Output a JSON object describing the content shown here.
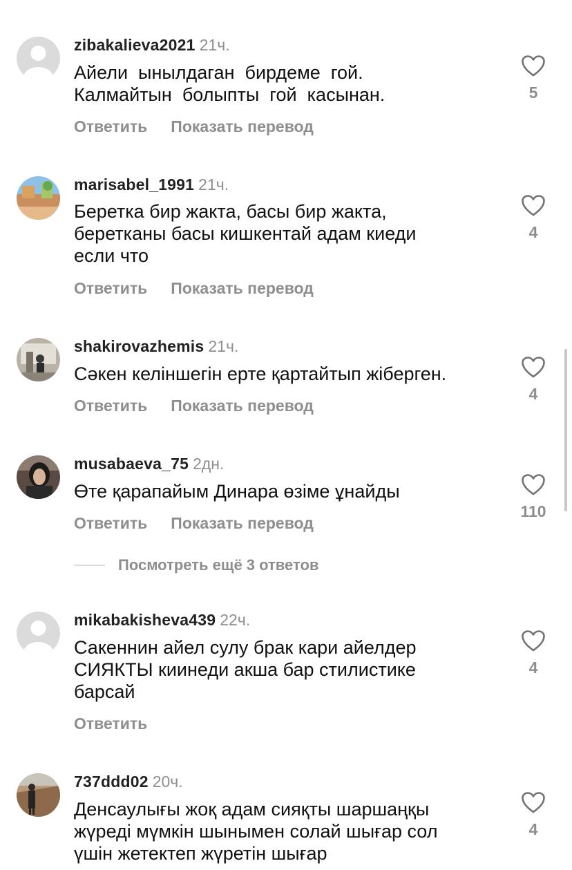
{
  "actions": {
    "reply": "Ответить",
    "translate": "Показать перевод"
  },
  "view_more_replies": "Посмотреть ещё 3 ответов",
  "comments": [
    {
      "username": "zibakalieva2021",
      "time": "21ч.",
      "line1": "Айели  ынылдаган  бирдеме  гой.",
      "line2": "Калмайтын  болыпты  гой  касынан.",
      "line3": "",
      "likes": "5"
    },
    {
      "username": "marisabel_1991",
      "time": "21ч.",
      "line1": "Беретка бир жакта, басы бир жакта,",
      "line2": "беретканы басы кишкентай адам киеди",
      "line3": "если что",
      "likes": "4"
    },
    {
      "username": "shakirovazhemis",
      "time": "21ч.",
      "line1": "Сәкен келіншегін ерте қартайтып жіберген.",
      "line2": "",
      "line3": "",
      "likes": "4"
    },
    {
      "username": "musabaeva_75",
      "time": "2дн.",
      "line1": "Өте қарапайым Динара өзіме ұнайды",
      "line2": "",
      "line3": "",
      "likes": "110"
    },
    {
      "username": "mikabakisheva439",
      "time": "22ч.",
      "line1": "Сакеннин айел сулу брак кари айелдер",
      "line2": "СИЯКТЫ киинеди акша бар стилистике",
      "line3": "барсай",
      "likes": "4"
    },
    {
      "username": "737ddd02",
      "time": "20ч.",
      "line1": "Денсаулығы жоқ адам сияқты шаршаңқы",
      "line2": "жүреді мүмкін шынымен солай шығар сол",
      "line3": "үшін жетектеп жүретін шығар",
      "likes": "4"
    }
  ]
}
